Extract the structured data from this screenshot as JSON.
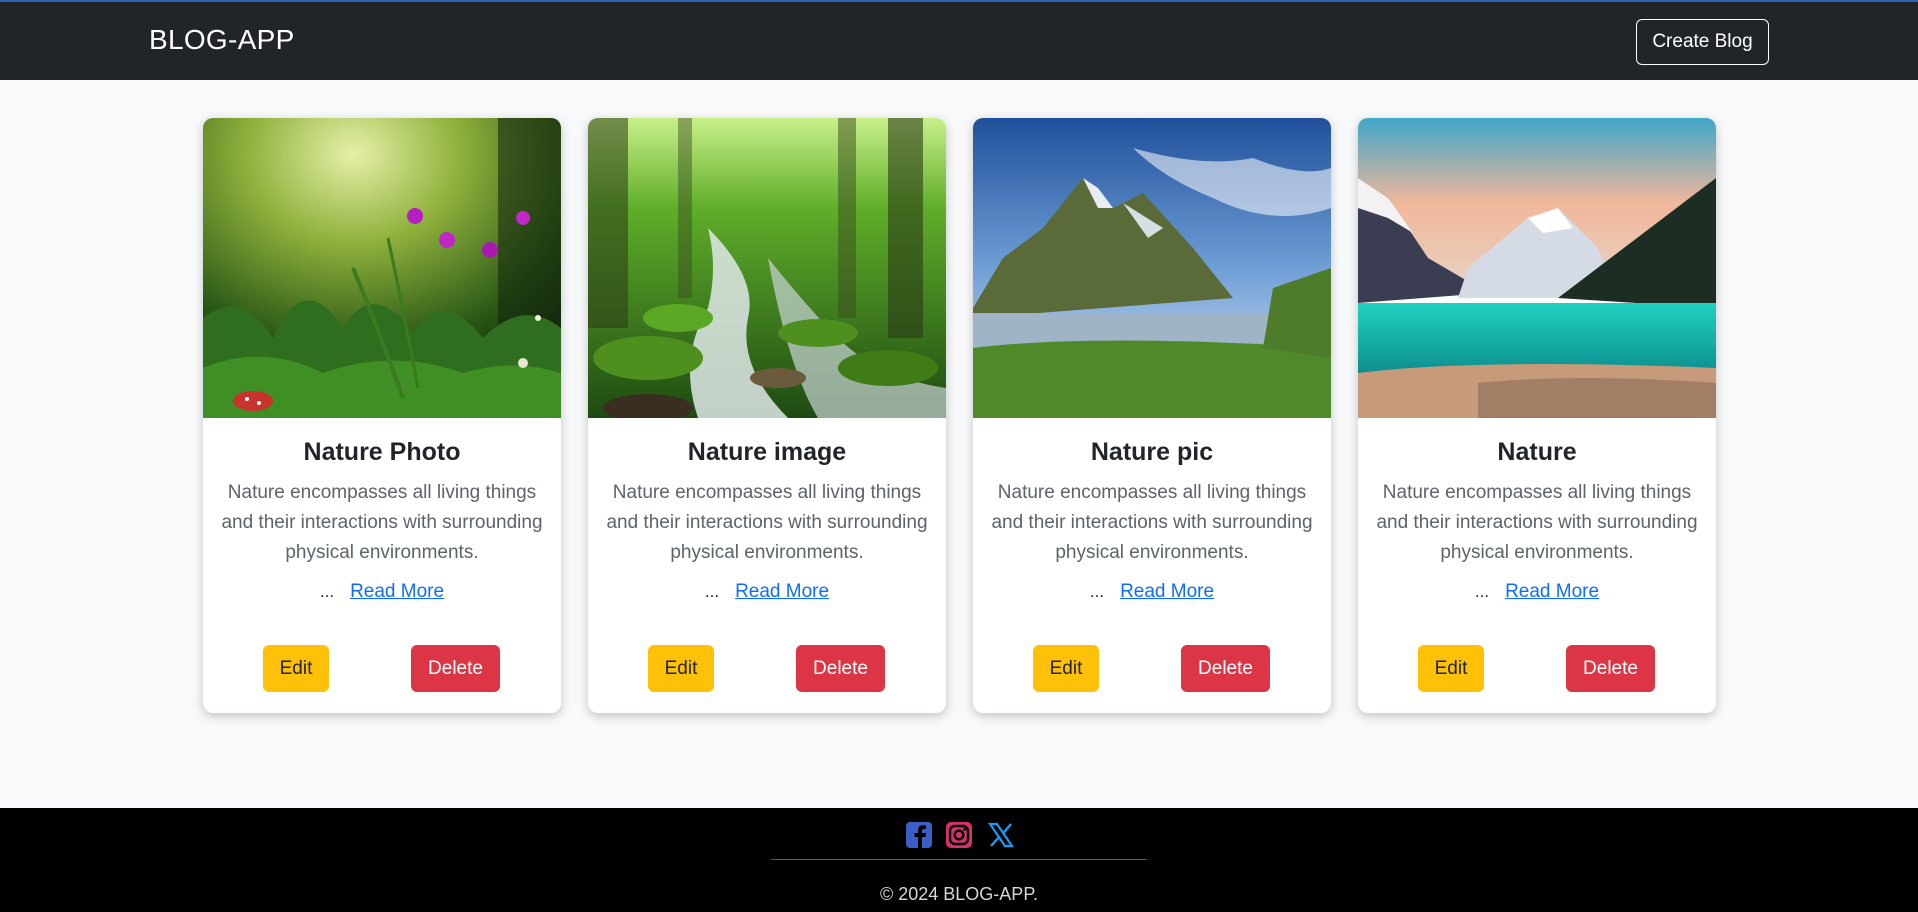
{
  "navbar": {
    "brand": "BLOG-APP",
    "create_label": "Create Blog"
  },
  "cards": [
    {
      "title": "Nature Photo",
      "text": "Nature encompasses all living things and their interactions with surrounding physical environments.",
      "ellipsis": "...",
      "read_more": "Read More",
      "edit_label": "Edit",
      "delete_label": "Delete"
    },
    {
      "title": "Nature image",
      "text": "Nature encompasses all living things and their interactions with surrounding physical environments.",
      "ellipsis": "...",
      "read_more": "Read More",
      "edit_label": "Edit",
      "delete_label": "Delete"
    },
    {
      "title": "Nature pic",
      "text": "Nature encompasses all living things and their interactions with surrounding physical environments.",
      "ellipsis": "...",
      "read_more": "Read More",
      "edit_label": "Edit",
      "delete_label": "Delete"
    },
    {
      "title": "Nature",
      "text": "Nature encompasses all living things and their interactions with surrounding physical environments.",
      "ellipsis": "...",
      "read_more": "Read More",
      "edit_label": "Edit",
      "delete_label": "Delete"
    }
  ],
  "footer": {
    "social_icons": [
      "facebook-icon",
      "instagram-icon",
      "x-icon"
    ],
    "copyright": "© 2024 BLOG-APP."
  },
  "colors": {
    "navbar_bg": "#212529",
    "page_bg": "#f8f9fa",
    "edit_button": "#ffc107",
    "delete_button": "#dc3545",
    "link": "#0d6efd",
    "footer_bg": "#000000"
  }
}
